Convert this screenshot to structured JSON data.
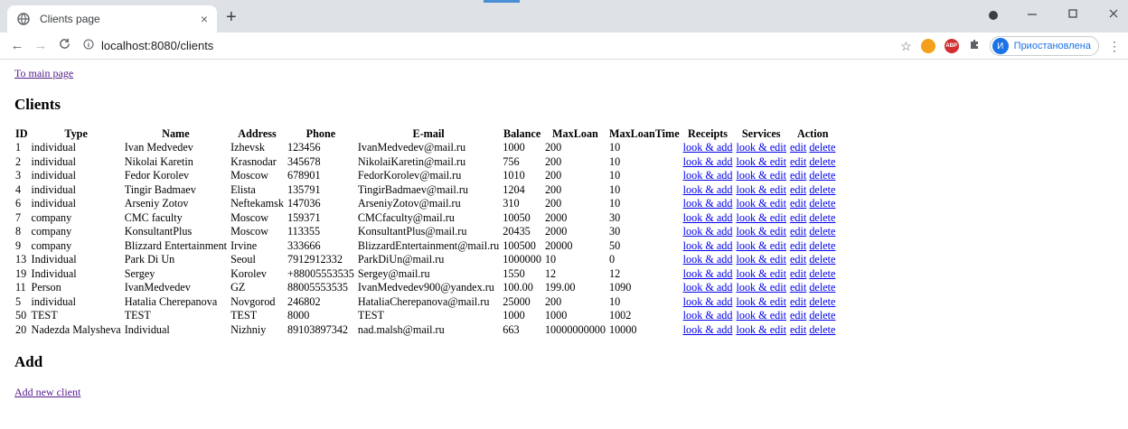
{
  "browser": {
    "tab_title": "Clients page",
    "tab_close": "×",
    "new_tab": "+",
    "url": "localhost:8080/clients",
    "profile_initial": "И",
    "profile_label": "Приостановлена"
  },
  "page": {
    "main_link": "To main page",
    "clients_heading": "Clients",
    "add_heading": "Add",
    "add_link": "Add new client"
  },
  "table": {
    "headers": [
      "ID",
      "Type",
      "Name",
      "Address",
      "Phone",
      "E-mail",
      "Balance",
      "MaxLoan",
      "MaxLoanTime",
      "Receipts",
      "Services",
      "Action"
    ],
    "action_labels": {
      "receipts": "look & add",
      "services": "look & edit",
      "edit": "edit",
      "delete": "delete"
    },
    "rows": [
      {
        "id": "1",
        "type": "individual",
        "name": "Ivan Medvedev",
        "address": "Izhevsk",
        "phone": "123456",
        "email": "IvanMedvedev@mail.ru",
        "balance": "1000",
        "maxloan": "200",
        "maxloantime": "10"
      },
      {
        "id": "2",
        "type": "individual",
        "name": "Nikolai Karetin",
        "address": "Krasnodar",
        "phone": "345678",
        "email": "NikolaiKaretin@mail.ru",
        "balance": "756",
        "maxloan": "200",
        "maxloantime": "10"
      },
      {
        "id": "3",
        "type": "individual",
        "name": "Fedor Korolev",
        "address": "Moscow",
        "phone": "678901",
        "email": "FedorKorolev@mail.ru",
        "balance": "1010",
        "maxloan": "200",
        "maxloantime": "10"
      },
      {
        "id": "4",
        "type": "individual",
        "name": "Tingir Badmaev",
        "address": "Elista",
        "phone": "135791",
        "email": "TingirBadmaev@mail.ru",
        "balance": "1204",
        "maxloan": "200",
        "maxloantime": "10"
      },
      {
        "id": "6",
        "type": "individual",
        "name": "Arseniy Zotov",
        "address": "Neftekamsk",
        "phone": "147036",
        "email": "ArseniyZotov@mail.ru",
        "balance": "310",
        "maxloan": "200",
        "maxloantime": "10"
      },
      {
        "id": "7",
        "type": "company",
        "name": "CMC faculty",
        "address": "Moscow",
        "phone": "159371",
        "email": "CMCfaculty@mail.ru",
        "balance": "10050",
        "maxloan": "2000",
        "maxloantime": "30"
      },
      {
        "id": "8",
        "type": "company",
        "name": "KonsultantPlus",
        "address": "Moscow",
        "phone": "113355",
        "email": "KonsultantPlus@mail.ru",
        "balance": "20435",
        "maxloan": "2000",
        "maxloantime": "30"
      },
      {
        "id": "9",
        "type": "company",
        "name": "Blizzard Entertainment",
        "address": "Irvine",
        "phone": "333666",
        "email": "BlizzardEntertainment@mail.ru",
        "balance": "100500",
        "maxloan": "20000",
        "maxloantime": "50"
      },
      {
        "id": "13",
        "type": "Individual",
        "name": "Park Di Un",
        "address": "Seoul",
        "phone": "7912912332",
        "email": "ParkDiUn@mail.ru",
        "balance": "1000000",
        "maxloan": "10",
        "maxloantime": "0"
      },
      {
        "id": "19",
        "type": "Individual",
        "name": "Sergey",
        "address": "Korolev",
        "phone": "+88005553535",
        "email": "Sergey@mail.ru",
        "balance": "1550",
        "maxloan": "12",
        "maxloantime": "12"
      },
      {
        "id": "11",
        "type": "Person",
        "name": "IvanMedvedev",
        "address": "GZ",
        "phone": "88005553535",
        "email": "IvanMedvedev900@yandex.ru",
        "balance": "100.00",
        "maxloan": "199.00",
        "maxloantime": "1090"
      },
      {
        "id": "5",
        "type": "individual",
        "name": "Hatalia Cherepanova",
        "address": "Novgorod",
        "phone": "246802",
        "email": "HataliaCherepanova@mail.ru",
        "balance": "25000",
        "maxloan": "200",
        "maxloantime": "10"
      },
      {
        "id": "50",
        "type": "TEST",
        "name": "TEST",
        "address": "TEST",
        "phone": "8000",
        "email": "TEST",
        "balance": "1000",
        "maxloan": "1000",
        "maxloantime": "1002"
      },
      {
        "id": "20",
        "type": "Nadezda Malysheva",
        "name": "Individual",
        "address": "Nizhniy",
        "phone": "89103897342",
        "email": "nad.malsh@mail.ru",
        "balance": "663",
        "maxloan": "10000000000",
        "maxloantime": "10000"
      }
    ]
  }
}
